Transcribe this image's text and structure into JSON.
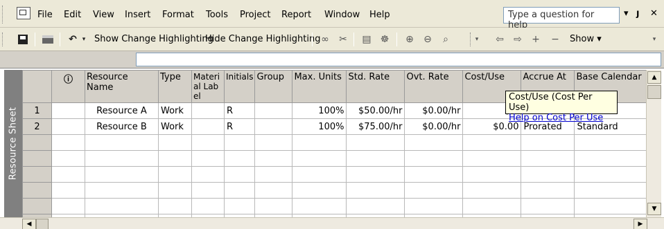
{
  "menubar": {
    "items": [
      {
        "label": "File",
        "key": "F"
      },
      {
        "label": "Edit",
        "key": "E"
      },
      {
        "label": "View",
        "key": "V"
      },
      {
        "label": "Insert",
        "key": "I"
      },
      {
        "label": "Format",
        "key": "o"
      },
      {
        "label": "Tools",
        "key": "T"
      },
      {
        "label": "Project",
        "key": "P"
      },
      {
        "label": "Report",
        "key": "R"
      },
      {
        "label": "Window",
        "key": "W"
      },
      {
        "label": "Help",
        "key": "H"
      }
    ],
    "help_placeholder": "Type a question for help",
    "window_controls": [
      "▾",
      "ȷ",
      "✕"
    ]
  },
  "toolbar": {
    "show_change_label": "Show Change Highlighting",
    "hide_change_label": "Hide Change Highlighting",
    "show_label": "Show ▾",
    "icons": [
      "save-icon",
      "print-icon",
      "undo-icon",
      "link-icon",
      "unlink-icon",
      "task-info-icon",
      "assign-resources-icon",
      "zoom-in-icon",
      "zoom-out-icon",
      "copy-picture-icon",
      "outdent-icon",
      "indent-icon",
      "show-subtasks-icon",
      "hide-subtasks-icon"
    ]
  },
  "sheet": {
    "view_label": "Resource Sheet",
    "columns": [
      "",
      "ⓘ",
      "Resource Name",
      "Type",
      "Material Label",
      "Initials",
      "Group",
      "Max. Units",
      "Std. Rate",
      "Ovt. Rate",
      "Cost/Use",
      "Accrue At",
      "Base Calendar"
    ],
    "rows": [
      {
        "id": "1",
        "indicator": "",
        "name": "Resource A",
        "type": "Work",
        "material": "",
        "initials": "R",
        "group": "",
        "max_units": "100%",
        "std_rate": "$50.00/hr",
        "ovt_rate": "$0.00/hr",
        "cost_use": "$0.",
        "accrue": "",
        "calendar": ""
      },
      {
        "id": "2",
        "indicator": "",
        "name": "Resource B",
        "type": "Work",
        "material": "",
        "initials": "R",
        "group": "",
        "max_units": "100%",
        "std_rate": "$75.00/hr",
        "ovt_rate": "$0.00/hr",
        "cost_use": "$0.00",
        "accrue": "Prorated",
        "calendar": "Standard"
      }
    ],
    "empty_rows": 6
  },
  "tooltip": {
    "title": "Cost/Use (Cost Per Use)",
    "link": "Help on Cost Per Use"
  }
}
